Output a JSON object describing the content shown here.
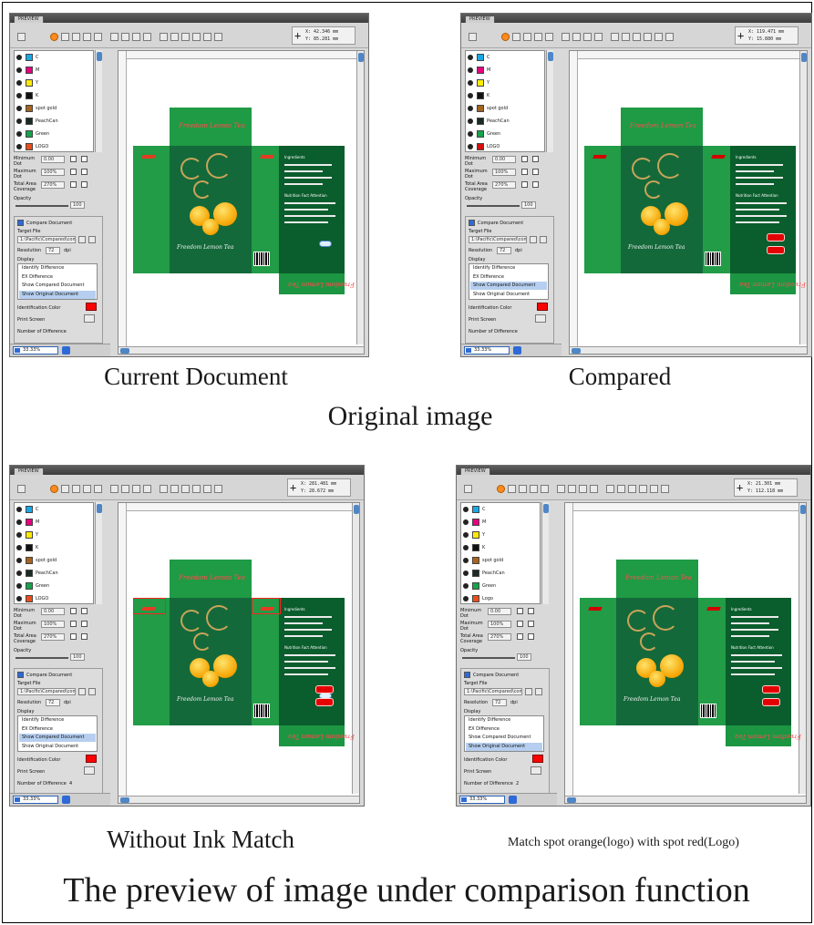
{
  "panels": [
    {
      "id": "current",
      "tab": "PREVIEW",
      "readout": [
        "X: 42.346 mm",
        "Y: 85.281 mm"
      ],
      "inks": [
        {
          "name": "C",
          "color": "#18a8e6"
        },
        {
          "name": "M",
          "color": "#e6007e"
        },
        {
          "name": "Y",
          "color": "#ffec00"
        },
        {
          "name": "K",
          "color": "#111111"
        },
        {
          "name": "spot gold",
          "color": "#a5641f"
        },
        {
          "name": "PeachCan",
          "color": "#1a2a24"
        },
        {
          "name": "Green",
          "color": "#16a34a"
        },
        {
          "name": "LOGO",
          "color": "#e94e1b"
        }
      ],
      "params": [
        {
          "label": "Minimum Dot",
          "value": "0.00"
        },
        {
          "label": "Maximum Dot",
          "value": "100%"
        },
        {
          "label": "Total Area Coverage",
          "value": "270%"
        }
      ],
      "opacity_label": "Opacity",
      "opacity_value": "100",
      "compare_label": "Compare Document",
      "target_label": "Target File",
      "target_path": "1:\\Pacific\\Compared\\compare.ai",
      "resolution_label": "Resolution",
      "resolution_value": "72",
      "resolution_unit": "dpi",
      "display_label": "Display",
      "display_items": [
        "Identify Difference",
        "EX Difference",
        "Show Compared Document",
        "Show Original Document"
      ],
      "display_selected": 3,
      "ident_color_label": "Identification Color",
      "print_screen_label": "Print Screen",
      "diff_count_label": "Number of Difference",
      "diff_count_value": "",
      "zoom": "33.33%"
    },
    {
      "id": "compared",
      "tab": "PREVIEW",
      "readout": [
        "X: 119.471 mm",
        "Y: 15.880 mm"
      ],
      "inks": [
        {
          "name": "C",
          "color": "#18a8e6"
        },
        {
          "name": "M",
          "color": "#e6007e"
        },
        {
          "name": "Y",
          "color": "#ffec00"
        },
        {
          "name": "K",
          "color": "#111111"
        },
        {
          "name": "spot gold",
          "color": "#a5641f"
        },
        {
          "name": "PeachCan",
          "color": "#1a2a24"
        },
        {
          "name": "Green",
          "color": "#16a34a"
        },
        {
          "name": "LOGO",
          "color": "#d41010"
        }
      ],
      "params": [
        {
          "label": "Minimum Dot",
          "value": "0.00"
        },
        {
          "label": "Maximum Dot",
          "value": "100%"
        },
        {
          "label": "Total Area Coverage",
          "value": "270%"
        }
      ],
      "opacity_label": "Opacity",
      "opacity_value": "100",
      "compare_label": "Compare Document",
      "target_label": "Target File",
      "target_path": "1:\\Pacific\\Compared\\compare.ai",
      "resolution_label": "Resolution",
      "resolution_value": "72",
      "resolution_unit": "dpi",
      "display_label": "Display",
      "display_items": [
        "Identify Difference",
        "EX Difference",
        "Show Compared Document",
        "Show Original Document"
      ],
      "display_selected": 2,
      "ident_color_label": "Identification Color",
      "print_screen_label": "Print Screen",
      "diff_count_label": "Number of Difference",
      "diff_count_value": "",
      "zoom": "33.33%"
    },
    {
      "id": "without-ink-match",
      "tab": "PREVIEW",
      "readout": [
        "X: 281.481 mm",
        "Y: 28.672 mm"
      ],
      "inks": [
        {
          "name": "C",
          "color": "#18a8e6"
        },
        {
          "name": "M",
          "color": "#e6007e"
        },
        {
          "name": "Y",
          "color": "#ffec00"
        },
        {
          "name": "K",
          "color": "#111111"
        },
        {
          "name": "spot gold",
          "color": "#a5641f"
        },
        {
          "name": "PeachCan",
          "color": "#1a2a24"
        },
        {
          "name": "Green",
          "color": "#16a34a"
        },
        {
          "name": "LOGO",
          "color": "#e94e1b"
        }
      ],
      "params": [
        {
          "label": "Minimum Dot",
          "value": "0.00"
        },
        {
          "label": "Maximum Dot",
          "value": "100%"
        },
        {
          "label": "Total Area Coverage",
          "value": "270%"
        }
      ],
      "opacity_label": "Opacity",
      "opacity_value": "100",
      "compare_label": "Compare Document",
      "target_label": "Target File",
      "target_path": "1:\\Pacific\\Compared\\compare.ai",
      "resolution_label": "Resolution",
      "resolution_value": "72",
      "resolution_unit": "dpi",
      "display_label": "Display",
      "display_items": [
        "Identify Difference",
        "EX Difference",
        "Show Compared Document",
        "Show Original Document"
      ],
      "display_selected": 2,
      "ident_color_label": "Identification Color",
      "print_screen_label": "Print Screen",
      "diff_count_label": "Number of Difference",
      "diff_count_value": "4",
      "zoom": "33.33%"
    },
    {
      "id": "match-spot",
      "tab": "PREVIEW",
      "readout": [
        "X: 21.301 mm",
        "Y: 112.118 mm"
      ],
      "inks": [
        {
          "name": "C",
          "color": "#18a8e6"
        },
        {
          "name": "M",
          "color": "#e6007e"
        },
        {
          "name": "Y",
          "color": "#ffec00"
        },
        {
          "name": "K",
          "color": "#111111"
        },
        {
          "name": "spot gold",
          "color": "#a5641f"
        },
        {
          "name": "PeachCan",
          "color": "#1a2a24"
        },
        {
          "name": "Green",
          "color": "#16a34a"
        },
        {
          "name": "Logo",
          "color": "#e94e1b"
        }
      ],
      "params": [
        {
          "label": "Minimum Dot",
          "value": "0.00"
        },
        {
          "label": "Maximum Dot",
          "value": "100%"
        },
        {
          "label": "Total Area Coverage",
          "value": "270%"
        }
      ],
      "opacity_label": "Opacity",
      "opacity_value": "100",
      "compare_label": "Compare Document",
      "target_label": "Target File",
      "target_path": "1:\\Pacific\\Compared\\compare.ai",
      "resolution_label": "Resolution",
      "resolution_value": "72",
      "resolution_unit": "dpi",
      "display_label": "Display",
      "display_items": [
        "Identify Difference",
        "EX Difference",
        "Show Compared Document",
        "Show Original Document"
      ],
      "display_selected": 3,
      "ident_color_label": "Identification Color",
      "print_screen_label": "Print Screen",
      "diff_count_label": "Number of Difference",
      "diff_count_value": "2",
      "zoom": "33.33%"
    }
  ],
  "package": {
    "brand": "Freedom Lemon Tea",
    "side_heading": "Ingredients",
    "side_heading2": "Nutrition Fact Attention"
  },
  "captions": {
    "current": "Current Document",
    "compared": "Compared",
    "original": "Original image",
    "without": "Without Ink Match",
    "match": "Match spot orange(logo) with spot red(Logo)",
    "footer": "The preview of image under comparison function"
  },
  "colors": {
    "identification": "#ff0000",
    "package_green": "#229c47",
    "front_dark_green": "#14693a",
    "selection_blue": "#b6cff0"
  }
}
